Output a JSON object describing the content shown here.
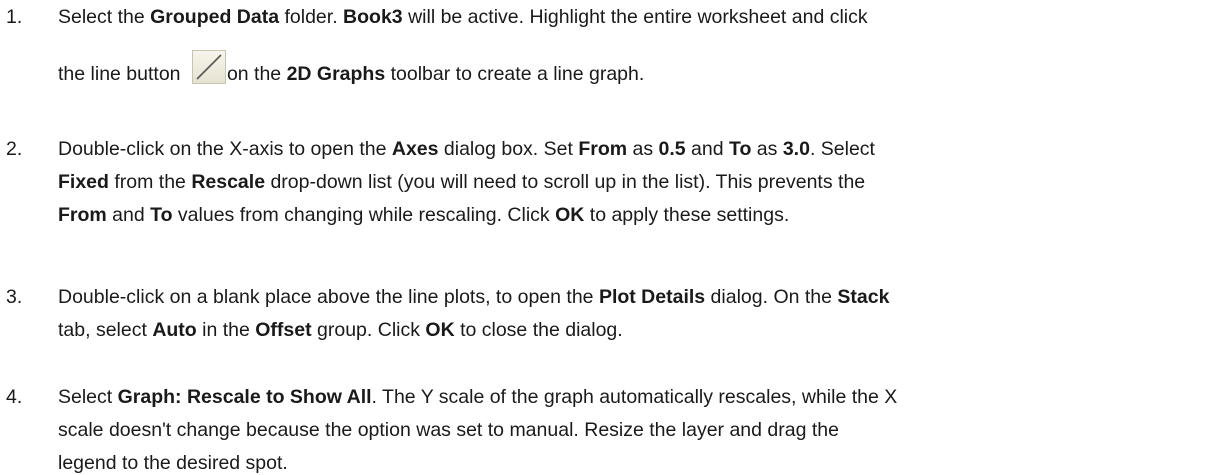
{
  "steps": [
    {
      "number": "1.",
      "lines": [
        [
          {
            "t": "Select the ",
            "b": false
          },
          {
            "t": "Grouped Data",
            "b": true
          },
          {
            "t": " folder. ",
            "b": false
          },
          {
            "t": "Book3",
            "b": true
          },
          {
            "t": " will be active. Highlight the entire worksheet and click",
            "b": false
          }
        ],
        [
          {
            "t": "the line button ",
            "b": false
          },
          {
            "icon": "line-graph-button-icon"
          },
          {
            "t": "on the ",
            "b": false
          },
          {
            "t": "2D Graphs",
            "b": true
          },
          {
            "t": " toolbar to create a line graph.",
            "b": false
          }
        ]
      ]
    },
    {
      "number": "2.",
      "lines": [
        [
          {
            "t": "Double-click on the X-axis to open the ",
            "b": false
          },
          {
            "t": "Axes",
            "b": true
          },
          {
            "t": " dialog box. Set ",
            "b": false
          },
          {
            "t": "From",
            "b": true
          },
          {
            "t": " as ",
            "b": false
          },
          {
            "t": "0.5",
            "b": true
          },
          {
            "t": " and ",
            "b": false
          },
          {
            "t": "To",
            "b": true
          },
          {
            "t": " as ",
            "b": false
          },
          {
            "t": "3.0",
            "b": true
          },
          {
            "t": ". Select",
            "b": false
          }
        ],
        [
          {
            "t": "Fixed",
            "b": true
          },
          {
            "t": " from the ",
            "b": false
          },
          {
            "t": "Rescale",
            "b": true
          },
          {
            "t": " drop-down list (you will need to scroll up in the list). This prevents the",
            "b": false
          }
        ],
        [
          {
            "t": "From",
            "b": true
          },
          {
            "t": " and ",
            "b": false
          },
          {
            "t": "To",
            "b": true
          },
          {
            "t": " values from changing while rescaling. Click ",
            "b": false
          },
          {
            "t": "OK",
            "b": true
          },
          {
            "t": " to apply these settings.",
            "b": false
          }
        ]
      ]
    },
    {
      "number": "3.",
      "lines": [
        [
          {
            "t": "Double-click on a blank place above the line plots, to open the ",
            "b": false
          },
          {
            "t": "Plot Details",
            "b": true
          },
          {
            "t": " dialog. On the ",
            "b": false
          },
          {
            "t": "Stack",
            "b": true
          }
        ],
        [
          {
            "t": "tab, select ",
            "b": false
          },
          {
            "t": "Auto",
            "b": true
          },
          {
            "t": " in the ",
            "b": false
          },
          {
            "t": "Offset",
            "b": true
          },
          {
            "t": " group. Click ",
            "b": false
          },
          {
            "t": "OK",
            "b": true
          },
          {
            "t": " to close the dialog.",
            "b": false
          }
        ]
      ]
    },
    {
      "number": "4.",
      "lines": [
        [
          {
            "t": "Select ",
            "b": false
          },
          {
            "t": "Graph: Rescale to Show All",
            "b": true
          },
          {
            "t": ". The Y scale of the graph automatically rescales, while the X",
            "b": false
          }
        ],
        [
          {
            "t": "scale doesn't change because the option was set to manual. Resize the layer and drag the",
            "b": false
          }
        ],
        [
          {
            "t": "legend to the desired spot.",
            "b": false
          }
        ]
      ]
    }
  ]
}
